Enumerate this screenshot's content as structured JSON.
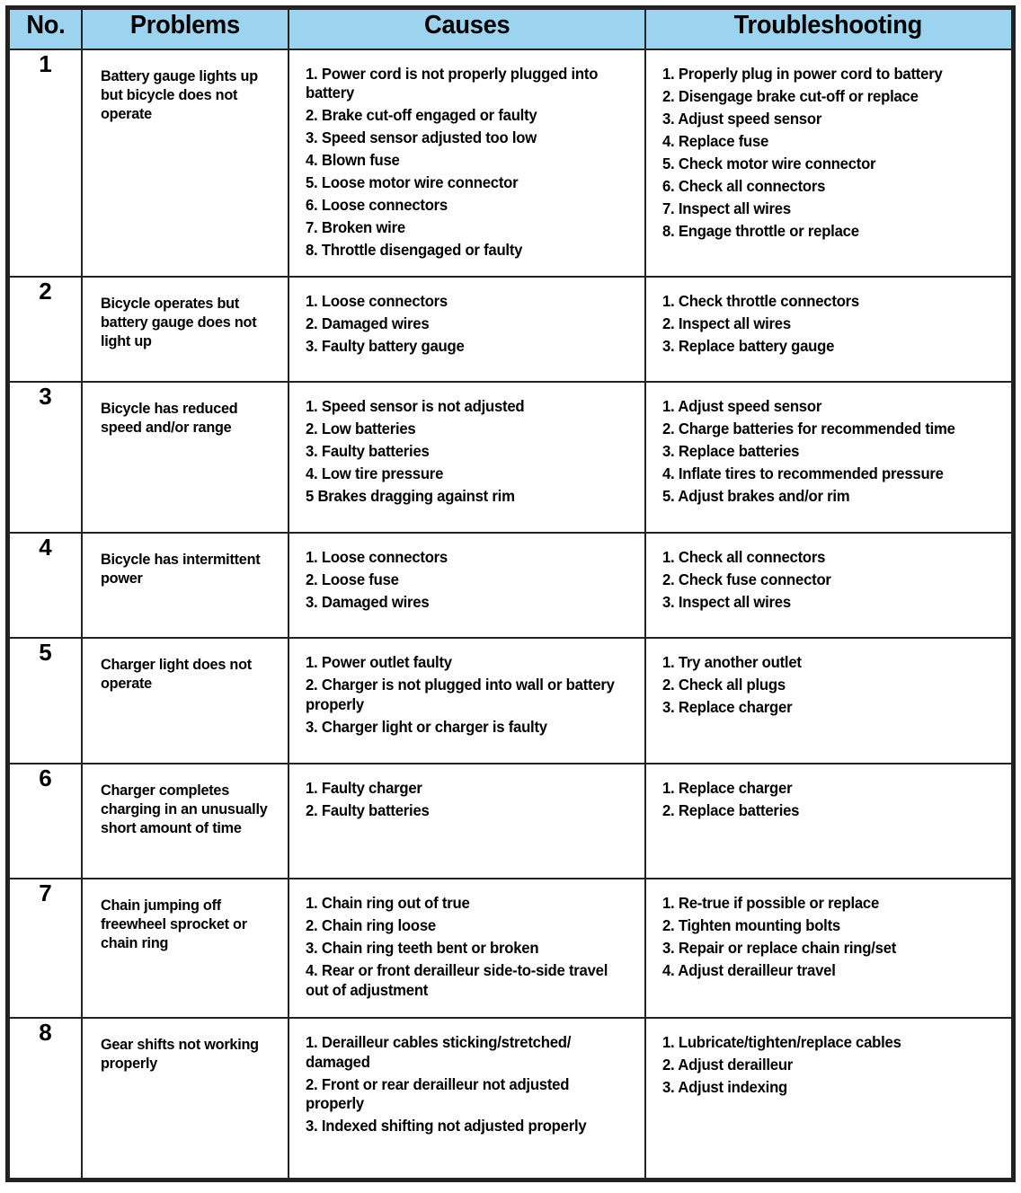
{
  "table": {
    "columns": [
      "No.",
      "Problems",
      "Causes",
      "Troubleshooting"
    ],
    "header": {
      "col_no": "No.",
      "col_problems": "Problems",
      "col_causes": "Causes",
      "col_troubleshooting": "Troubleshooting"
    },
    "colors": {
      "header_background": "#9CD3EE",
      "border": "#222222",
      "cell_background": "#FFFFFF",
      "text": "#000000"
    },
    "rows": [
      {
        "no": "1",
        "problem": "Battery gauge lights up but bicycle does not operate",
        "causes": [
          "1. Power cord is not properly plugged into battery",
          "2. Brake cut-off engaged or faulty",
          "3. Speed sensor adjusted too low",
          "4. Blown fuse",
          "5. Loose motor wire connector",
          "6. Loose connectors",
          "7. Broken wire",
          "8. Throttle disengaged or faulty"
        ],
        "troubleshooting": [
          "1. Properly plug in power cord to battery",
          "2. Disengage brake cut-off or replace",
          "3. Adjust speed sensor",
          "4. Replace fuse",
          "5. Check motor wire connector",
          "6. Check all connectors",
          "7. Inspect all wires",
          "8. Engage throttle or replace"
        ]
      },
      {
        "no": "2",
        "problem": "Bicycle operates but battery gauge does not light up",
        "causes": [
          "1. Loose connectors",
          "2. Damaged wires",
          "3. Faulty battery gauge"
        ],
        "troubleshooting": [
          "1. Check throttle connectors",
          "2. Inspect all wires",
          "3. Replace battery gauge"
        ]
      },
      {
        "no": "3",
        "problem": "Bicycle has reduced speed and/or range",
        "causes": [
          "1. Speed sensor is not adjusted",
          "2. Low batteries",
          "3. Faulty batteries",
          "4. Low tire pressure",
          "5 Brakes dragging against rim"
        ],
        "troubleshooting": [
          "1. Adjust speed sensor",
          "2. Charge batteries for recommended time",
          "3. Replace batteries",
          "4. Inflate tires to recommended pressure",
          "5. Adjust brakes and/or rim"
        ]
      },
      {
        "no": "4",
        "problem": "Bicycle has intermittent power",
        "causes": [
          "1. Loose connectors",
          "2. Loose fuse",
          "3. Damaged wires"
        ],
        "troubleshooting": [
          "1. Check all connectors",
          "2. Check fuse connector",
          "3. Inspect all wires"
        ]
      },
      {
        "no": "5",
        "problem": "Charger light does not operate",
        "causes": [
          "1. Power outlet faulty",
          "2. Charger is not plugged into wall or battery properly",
          "3. Charger light or charger is faulty"
        ],
        "troubleshooting": [
          "1. Try another outlet",
          "2. Check all plugs",
          "3. Replace charger"
        ]
      },
      {
        "no": "6",
        "problem": "Charger completes charging in an unusually short amount of time",
        "causes": [
          "1. Faulty charger",
          "2. Faulty batteries"
        ],
        "troubleshooting": [
          "1. Replace charger",
          "2. Replace batteries"
        ]
      },
      {
        "no": "7",
        "problem": "Chain jumping off freewheel sprocket or chain ring",
        "causes": [
          "1. Chain ring out of true",
          "2. Chain ring loose",
          "3. Chain ring teeth bent or broken",
          "4. Rear or front derailleur side-to-side travel out of adjustment"
        ],
        "troubleshooting": [
          "1. Re-true if possible or replace",
          "2. Tighten mounting bolts",
          "3. Repair or replace chain ring/set",
          "4. Adjust derailleur travel"
        ]
      },
      {
        "no": "8",
        "problem": "Gear shifts not working properly",
        "causes": [
          "1. Derailleur cables sticking/stretched/ damaged",
          "2. Front or rear derailleur not adjusted properly",
          "3. Indexed shifting not adjusted properly"
        ],
        "troubleshooting": [
          "1. Lubricate/tighten/replace cables",
          "2. Adjust derailleur",
          "3. Adjust indexing"
        ]
      }
    ]
  }
}
